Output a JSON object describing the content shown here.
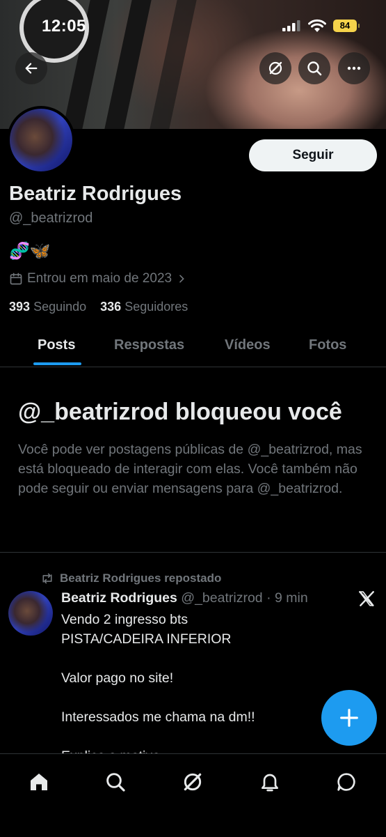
{
  "status_bar": {
    "time": "12:05",
    "battery": "84"
  },
  "profile": {
    "follow_label": "Seguir",
    "name": "Beatriz Rodrigues",
    "handle": "@_beatrizrod",
    "bio_emoji": "🧬🦋",
    "joined": "Entrou em maio de 2023",
    "following_count": "393",
    "following_label": "Seguindo",
    "followers_count": "336",
    "followers_label": "Seguidores"
  },
  "tabs": [
    {
      "label": "Posts",
      "active": true
    },
    {
      "label": "Respostas"
    },
    {
      "label": "Vídeos"
    },
    {
      "label": "Fotos"
    }
  ],
  "blocked": {
    "title": "@_beatrizrod bloqueou você",
    "text": "Você pode ver postagens públicas de @_beatrizrod, mas está bloqueado de interagir com elas. Você também não pode seguir ou enviar mensagens para @_beatrizrod."
  },
  "post": {
    "repost_label": "Beatriz Rodrigues repostado",
    "author_name": "Beatriz Rodrigues",
    "author_handle": "@_beatrizrod",
    "time": "· 9 min",
    "lines": [
      "Vendo 2 ingresso bts",
      "PISTA/CADEIRA INFERIOR",
      "Valor pago no site!",
      "Interessados me chama na dm!!",
      "Explico o motivo"
    ]
  },
  "colors": {
    "accent": "#1d9bf0",
    "background": "#000000",
    "secondary_text": "#71767b"
  },
  "icons": {
    "header": [
      "back-arrow-icon",
      "grok-icon",
      "search-icon",
      "more-icon"
    ],
    "nav": [
      "home-icon",
      "search-icon",
      "grok-icon",
      "notifications-icon",
      "messages-icon"
    ]
  }
}
